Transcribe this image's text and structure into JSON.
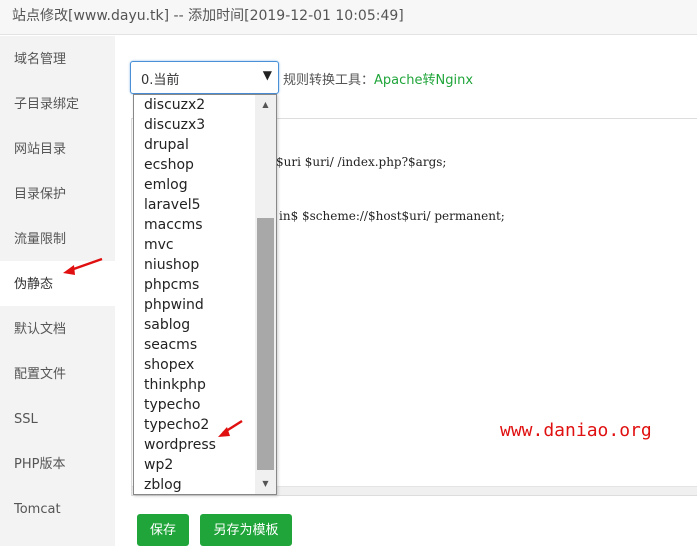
{
  "window": {
    "title": "站点修改[www.dayu.tk] -- 添加时间[2019-12-01 10:05:49]"
  },
  "sidebar": {
    "items": [
      {
        "label": "域名管理"
      },
      {
        "label": "子目录绑定"
      },
      {
        "label": "网站目录"
      },
      {
        "label": "目录保护"
      },
      {
        "label": "流量限制"
      },
      {
        "label": "伪静态"
      },
      {
        "label": "默认文档"
      },
      {
        "label": "配置文件"
      },
      {
        "label": "SSL"
      },
      {
        "label": "PHP版本"
      },
      {
        "label": "Tomcat"
      }
    ],
    "active": "伪静态"
  },
  "rewrite": {
    "selected": "0.当前",
    "tool_label": "规则转换工具：",
    "tool_link": "Apache转Nginx",
    "options": [
      "discuzx2",
      "discuzx3",
      "drupal",
      "ecshop",
      "emlog",
      "laravel5",
      "maccms",
      "mvc",
      "niushop",
      "phpcms",
      "phpwind",
      "sablog",
      "seacms",
      "shopex",
      "thinkphp",
      "typecho",
      "typecho2",
      "wordpress",
      "wp2",
      "zblog"
    ]
  },
  "editor": {
    "line1": "$uri $uri/ /index.php?$args;",
    "line2": "in$ $scheme://$host$uri/ permanent;"
  },
  "buttons": {
    "save": "保存",
    "save_template": "另存为模板"
  },
  "watermark": "www.daniao.org",
  "colors": {
    "accent": "#20a53a",
    "annotation": "#e01010",
    "focus_border": "#4a90d9"
  }
}
